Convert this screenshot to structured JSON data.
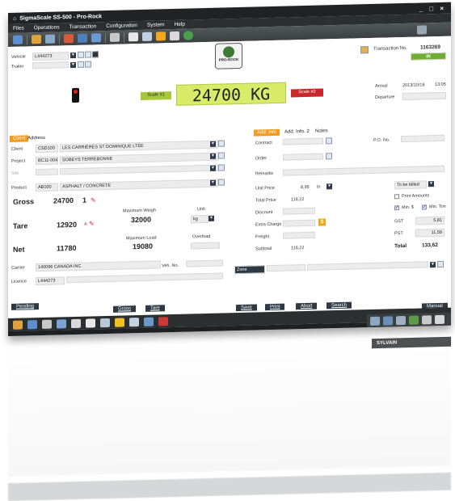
{
  "app": {
    "title": "SigmaScale SS-500 - Pro-Rock",
    "window_controls": "_ □ ×"
  },
  "menu": [
    "Files",
    "Operations",
    "Transaction",
    "Configuration",
    "System",
    "Help"
  ],
  "logo_text": "PRO-ROCK",
  "vehicle": {
    "label": "Vehicle",
    "value": "L444273",
    "trailer_label": "Trailer"
  },
  "scale": {
    "scale1": "Scale #1",
    "reading": "24700 KG",
    "scale2": "Scale #2"
  },
  "transaction": {
    "label": "Transaction No.",
    "number": "1163269",
    "status": "IN",
    "arrival_label": "Arrival",
    "arrival_date": "2013/10/18",
    "arrival_time": "13:05",
    "departure_label": "Departure"
  },
  "left_tabs": [
    "Client",
    "Address"
  ],
  "client": {
    "label": "Client",
    "code": "CSD100",
    "name": "LES CARRIÈRES ST DOMINIQUE LTÉE"
  },
  "project": {
    "label": "Project",
    "code": "BC11-004",
    "name": "SOBEYS TERREBONNE"
  },
  "site": {
    "label": "Site"
  },
  "product": {
    "label": "Product",
    "code": "AB100",
    "name": "ASPHALT / CONCRETE"
  },
  "weights": {
    "gross_label": "Gross",
    "gross": "24700",
    "gross_flag": "1",
    "tare_label": "Tare",
    "tare": "12920",
    "tare_flag": "A",
    "net_label": "Net",
    "net": "11780",
    "max_weight_label": "Maximum Weigh",
    "max_weight": "32000",
    "max_load_label": "Maximum Load",
    "max_load": "19080",
    "unit_label": "Unit",
    "unit": "kg",
    "overload_label": "Overload"
  },
  "carrier": {
    "label": "Carrier",
    "value": "140096 CANADA INC",
    "veh_label": "Veh. No.",
    "licence_label": "Licence",
    "licence": "L444273"
  },
  "right_tabs": [
    "Add. Info",
    "Add. Info. 2",
    "Notes"
  ],
  "info": {
    "contract": "Contract",
    "po": "P.O. No.",
    "order": "Order",
    "remarks": "Remarks"
  },
  "pricing": {
    "unit_price_label": "Unit Price",
    "unit_price": "8,95",
    "unit_price_unit": "tn",
    "total_price_label": "Total Price",
    "total_price": "116,22",
    "discount_label": "Discount",
    "extra_label": "Extra Charge",
    "freight_label": "Freight",
    "subtotal_label": "Subtotal",
    "subtotal": "116,22",
    "billing": "To be billed",
    "print_amounts": "Print Amounts",
    "min_dollar": "Min. $",
    "min_ton": "Min. Ton",
    "gst_label": "GST",
    "gst": "5,81",
    "pst_label": "PST",
    "pst": "11,59",
    "total_label": "Total",
    "total": "133,62"
  },
  "zone": {
    "label": "Zone"
  },
  "buttons": {
    "pending": "Pending",
    "gross": "Gross",
    "tare": "Tare",
    "save": "Save",
    "print": "Print",
    "abort": "Abort",
    "search": "Search",
    "manual": "Manual"
  },
  "status": {
    "user": "SYLVAIN"
  }
}
